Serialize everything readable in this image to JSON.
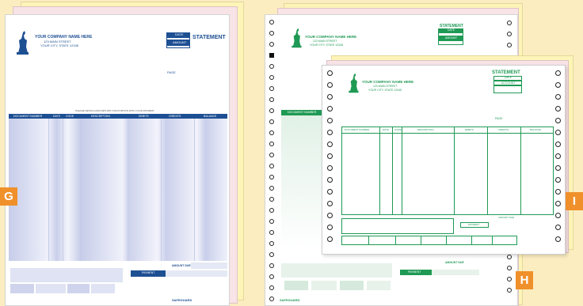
{
  "form_g": {
    "badge": "G",
    "company_name": "YOUR COMPANY NAME HERE",
    "street": "123 MAIN STREET",
    "city": "YOUR CITY, STATE 12345",
    "title": "STATEMENT",
    "date_label": "DATE",
    "amount_label": "AMOUNT",
    "page_label": "PAGE",
    "instruction": "PLEASE DETACH AND RETURN THIS PORTION WITH YOUR PAYMENT",
    "columns": [
      "DOCUMENT NUMBER",
      "DATE",
      "CODE",
      "DESCRIPTION",
      "DEBITS",
      "CREDITS",
      "BALANCE"
    ],
    "amount_due_label": "AMOUNT DUE",
    "payment_label": "PAYMENT",
    "brand": "SAFEGUARD"
  },
  "form_h": {
    "badge": "H",
    "company_name": "YOUR COMPANY NAME HERE",
    "street": "123 MAIN STREET",
    "city": "YOUR CITY, STATE 12345",
    "title": "STATEMENT",
    "date_label": "DATE",
    "amount_label": "AMOUNT",
    "doc_label": "DOCUMENT NUMBER",
    "amount_due_label": "AMOUNT DUE",
    "payment_label": "PAYMENT",
    "brand": "SAFEGUARD"
  },
  "form_i": {
    "badge": "I",
    "company_name": "YOUR COMPANY NAME HERE",
    "street": "123 MAIN STREET",
    "city": "YOUR CITY, STATE 12345",
    "title": "STATEMENT",
    "date_label": "DATE",
    "account_label": "ACCOUNT",
    "page_label": "PAGE",
    "columns": [
      "DOCUMENT NUMBER",
      "DATE",
      "CODE",
      "DESCRIPTION",
      "DEBITS",
      "CREDITS",
      "BALANCE"
    ],
    "amount due label": "AMOUNT DUE",
    "payment_label": "PAYMENT"
  },
  "colors": {
    "background": "#fbedc0",
    "brand_blue": "#1d4f93",
    "brand_green": "#1f9a55",
    "badge_orange": "#f0902a"
  }
}
